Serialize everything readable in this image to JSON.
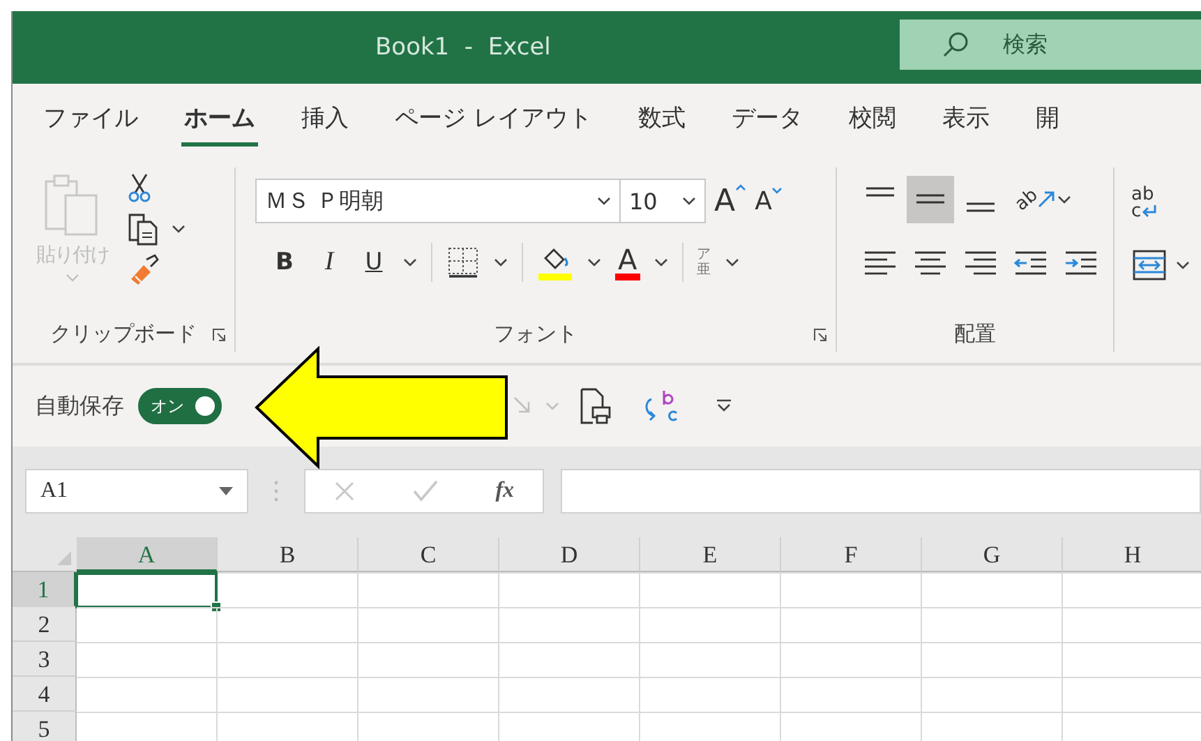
{
  "window": {
    "title": "Book1  -  Excel"
  },
  "search": {
    "placeholder": "検索"
  },
  "tabs": [
    {
      "label": "ファイル",
      "selected": false
    },
    {
      "label": "ホーム",
      "selected": true
    },
    {
      "label": "挿入",
      "selected": false
    },
    {
      "label": "ページ レイアウト",
      "selected": false
    },
    {
      "label": "数式",
      "selected": false
    },
    {
      "label": "データ",
      "selected": false
    },
    {
      "label": "校閲",
      "selected": false
    },
    {
      "label": "表示",
      "selected": false
    },
    {
      "label": "開",
      "selected": false
    }
  ],
  "clipboard": {
    "label": "クリップボード",
    "paste_label": "貼り付け"
  },
  "font": {
    "label": "フォント",
    "font_name": "ＭＳ Ｐ明朝",
    "font_size": "10",
    "grow_glyph": "A",
    "shrink_glyph": "A",
    "bold": "B",
    "italic": "I",
    "underline": "U",
    "color_glyph": "A",
    "phonetic_glyphs": [
      "ア",
      "亜"
    ]
  },
  "alignment": {
    "label": "配置",
    "orientation_glyph": "ab",
    "wrap_glyphs": [
      "ab",
      "c"
    ],
    "buttons": [
      {
        "kind": "top",
        "selected": false
      },
      {
        "kind": "middle",
        "selected": true
      },
      {
        "kind": "bottom",
        "selected": false
      },
      {
        "kind": "left",
        "selected": false
      },
      {
        "kind": "center",
        "selected": false
      },
      {
        "kind": "right",
        "selected": false
      },
      {
        "kind": "outdent",
        "selected": false
      },
      {
        "kind": "indent",
        "selected": false
      }
    ]
  },
  "autosave": {
    "label": "自動保存",
    "state_text": "オン",
    "on": true
  },
  "formula_bar": {
    "name_box": "A1",
    "function_label": "fx"
  },
  "sheet": {
    "columns": [
      {
        "label": "A",
        "selected": true
      },
      {
        "label": "B",
        "selected": false
      },
      {
        "label": "C",
        "selected": false
      },
      {
        "label": "D",
        "selected": false
      },
      {
        "label": "E",
        "selected": false
      },
      {
        "label": "F",
        "selected": false
      },
      {
        "label": "G",
        "selected": false
      },
      {
        "label": "H",
        "selected": false
      }
    ],
    "rows": [
      {
        "label": "1",
        "selected": true
      },
      {
        "label": "2",
        "selected": false
      },
      {
        "label": "3",
        "selected": false
      },
      {
        "label": "4",
        "selected": false
      },
      {
        "label": "5",
        "selected": false
      }
    ]
  }
}
